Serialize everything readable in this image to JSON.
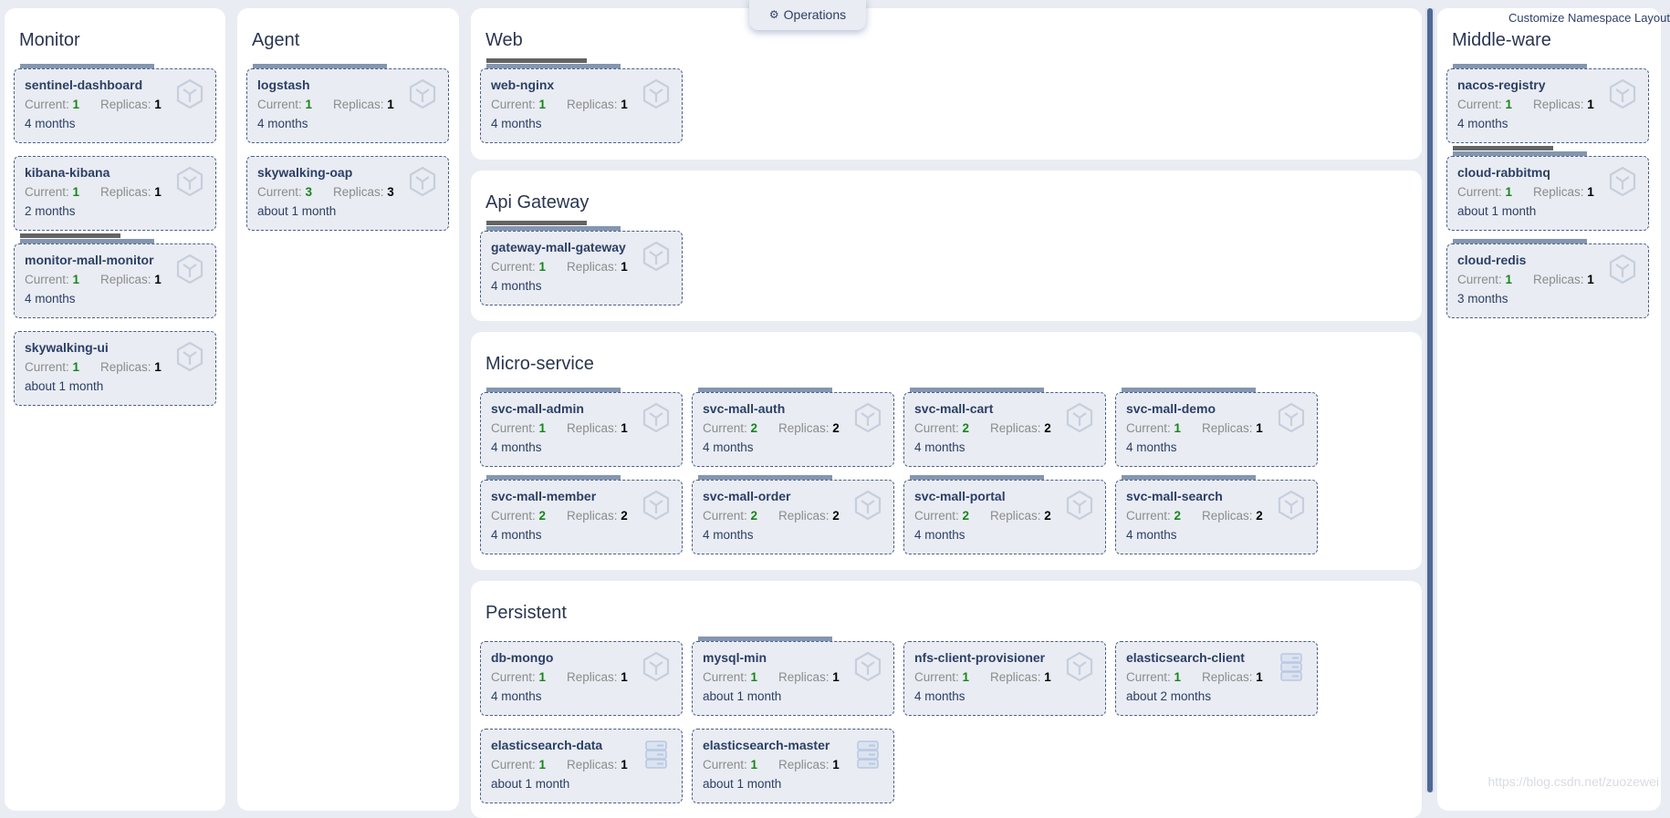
{
  "header": {
    "operations_label": "Operations",
    "operations_icon": "operations-icon",
    "customize_label": "Customize Namespace Layout"
  },
  "labels": {
    "current": "Current:",
    "replicas": "Replicas:"
  },
  "colors": {
    "current_value": "#17861b",
    "card_bg": "#e9ecf2",
    "card_border": "#4a5e88",
    "bar": "#8496b0",
    "bar_dark": "#646464"
  },
  "watermark": "https://blog.csdn.net/zuozewei",
  "sections": {
    "monitor": {
      "title": "Monitor",
      "items": [
        {
          "name": "sentinel-dashboard",
          "current": "1",
          "replicas": "1",
          "age": "4 months",
          "icon": "cube",
          "bars": "g"
        },
        {
          "name": "kibana-kibana",
          "current": "1",
          "replicas": "1",
          "age": "2 months",
          "icon": "cube",
          "bars": ""
        },
        {
          "name": "monitor-mall-monitor",
          "current": "1",
          "replicas": "1",
          "age": "4 months",
          "icon": "cube",
          "bars": "dg"
        },
        {
          "name": "skywalking-ui",
          "current": "1",
          "replicas": "1",
          "age": "about 1 month",
          "icon": "cube",
          "bars": ""
        }
      ]
    },
    "agent": {
      "title": "Agent",
      "items": [
        {
          "name": "logstash",
          "current": "1",
          "replicas": "1",
          "age": "4 months",
          "icon": "cube",
          "bars": "g"
        },
        {
          "name": "skywalking-oap",
          "current": "3",
          "replicas": "3",
          "age": "about 1 month",
          "icon": "cube",
          "bars": ""
        }
      ]
    },
    "web": {
      "title": "Web",
      "items": [
        {
          "name": "web-nginx",
          "current": "1",
          "replicas": "1",
          "age": "4 months",
          "icon": "cube",
          "bars": "dg"
        }
      ]
    },
    "apigw": {
      "title": "Api Gateway",
      "items": [
        {
          "name": "gateway-mall-gateway",
          "current": "1",
          "replicas": "1",
          "age": "4 months",
          "icon": "cube",
          "bars": "dg"
        }
      ]
    },
    "micro": {
      "title": "Micro-service",
      "items": [
        {
          "name": "svc-mall-admin",
          "current": "1",
          "replicas": "1",
          "age": "4 months",
          "icon": "cube",
          "bars": "g"
        },
        {
          "name": "svc-mall-auth",
          "current": "2",
          "replicas": "2",
          "age": "4 months",
          "icon": "cube",
          "bars": "g"
        },
        {
          "name": "svc-mall-cart",
          "current": "2",
          "replicas": "2",
          "age": "4 months",
          "icon": "cube",
          "bars": "g"
        },
        {
          "name": "svc-mall-demo",
          "current": "1",
          "replicas": "1",
          "age": "4 months",
          "icon": "cube",
          "bars": "g"
        },
        {
          "name": "svc-mall-member",
          "current": "2",
          "replicas": "2",
          "age": "4 months",
          "icon": "cube",
          "bars": "g"
        },
        {
          "name": "svc-mall-order",
          "current": "2",
          "replicas": "2",
          "age": "4 months",
          "icon": "cube",
          "bars": "g"
        },
        {
          "name": "svc-mall-portal",
          "current": "2",
          "replicas": "2",
          "age": "4 months",
          "icon": "cube",
          "bars": "g"
        },
        {
          "name": "svc-mall-search",
          "current": "2",
          "replicas": "2",
          "age": "4 months",
          "icon": "cube",
          "bars": "g"
        }
      ]
    },
    "persistent": {
      "title": "Persistent",
      "items": [
        {
          "name": "db-mongo",
          "current": "1",
          "replicas": "1",
          "age": "4 months",
          "icon": "cube",
          "bars": ""
        },
        {
          "name": "mysql-min",
          "current": "1",
          "replicas": "1",
          "age": "about 1 month",
          "icon": "cube",
          "bars": "g"
        },
        {
          "name": "nfs-client-provisioner",
          "current": "1",
          "replicas": "1",
          "age": "4 months",
          "icon": "cube",
          "bars": ""
        },
        {
          "name": "elasticsearch-client",
          "current": "1",
          "replicas": "1",
          "age": "about 2 months",
          "icon": "server",
          "bars": ""
        },
        {
          "name": "elasticsearch-data",
          "current": "1",
          "replicas": "1",
          "age": "about 1 month",
          "icon": "server",
          "bars": ""
        },
        {
          "name": "elasticsearch-master",
          "current": "1",
          "replicas": "1",
          "age": "about 1 month",
          "icon": "server",
          "bars": ""
        }
      ]
    },
    "middleware": {
      "title": "Middle-ware",
      "items": [
        {
          "name": "nacos-registry",
          "current": "1",
          "replicas": "1",
          "age": "4 months",
          "icon": "cube",
          "bars": "g"
        },
        {
          "name": "cloud-rabbitmq",
          "current": "1",
          "replicas": "1",
          "age": "about 1 month",
          "icon": "cube",
          "bars": "dg"
        },
        {
          "name": "cloud-redis",
          "current": "1",
          "replicas": "1",
          "age": "3 months",
          "icon": "cube",
          "bars": "g"
        }
      ]
    }
  }
}
